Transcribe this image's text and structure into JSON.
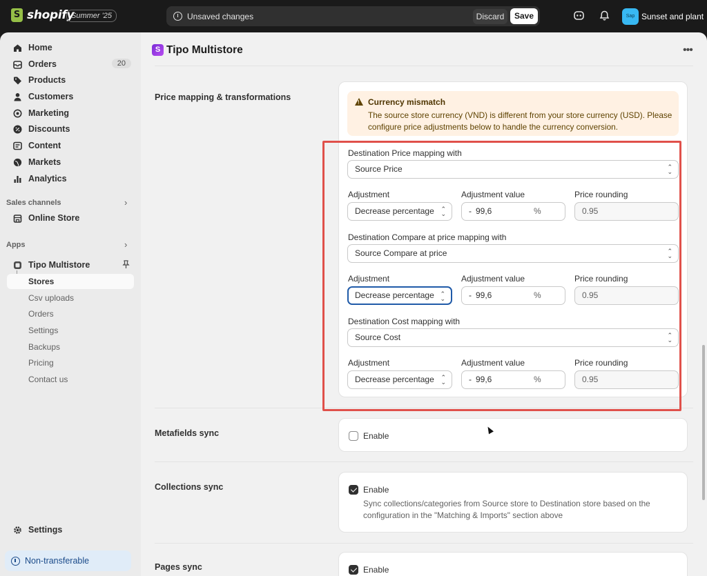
{
  "topbar": {
    "brand": "shopify",
    "edition_badge": "Summer '25",
    "unsaved_text": "Unsaved changes",
    "discard_label": "Discard",
    "save_label": "Save",
    "store_initials": "Sap",
    "store_name": "Sunset and plant"
  },
  "sidebar": {
    "items": [
      {
        "label": "Home",
        "icon": "home-icon"
      },
      {
        "label": "Orders",
        "icon": "orders-icon",
        "count": "20"
      },
      {
        "label": "Products",
        "icon": "tag-icon"
      },
      {
        "label": "Customers",
        "icon": "person-icon"
      },
      {
        "label": "Marketing",
        "icon": "target-icon"
      },
      {
        "label": "Discounts",
        "icon": "discount-icon"
      },
      {
        "label": "Content",
        "icon": "content-icon"
      },
      {
        "label": "Markets",
        "icon": "globe-icon"
      },
      {
        "label": "Analytics",
        "icon": "bar-chart-icon"
      }
    ],
    "sales_channels_label": "Sales channels",
    "online_store_label": "Online Store",
    "apps_label": "Apps",
    "app_name": "Tipo Multistore",
    "app_subitems": [
      "Stores",
      "Csv uploads",
      "Orders",
      "Settings",
      "Backups",
      "Pricing",
      "Contact us"
    ],
    "settings_label": "Settings",
    "nontransferable_label": "Non-transferable"
  },
  "main": {
    "app_title": "Tipo Multistore",
    "price_section_title": "Price mapping & transformations",
    "banner": {
      "title": "Currency mismatch",
      "text": "The source store currency (VND) is different from your store currency (USD). Please configure price adjustments below to handle the currency conversion."
    },
    "mappings": [
      {
        "label": "Destination Price mapping with",
        "source": "Source Price",
        "adjustment_label": "Adjustment",
        "adjustment": "Decrease percentage",
        "value_label": "Adjustment value",
        "value_prefix": "-",
        "value": "99,6",
        "value_suffix": "%",
        "rounding_label": "Price rounding",
        "rounding": "0.95"
      },
      {
        "label": "Destination Compare at price mapping with",
        "source": "Source Compare at price",
        "adjustment_label": "Adjustment",
        "adjustment": "Decrease percentage",
        "value_label": "Adjustment value",
        "value_prefix": "-",
        "value": "99,6",
        "value_suffix": "%",
        "rounding_label": "Price rounding",
        "rounding": "0.95"
      },
      {
        "label": "Destination Cost mapping with",
        "source": "Source Cost",
        "adjustment_label": "Adjustment",
        "adjustment": "Decrease percentage",
        "value_label": "Adjustment value",
        "value_prefix": "-",
        "value": "99,6",
        "value_suffix": "%",
        "rounding_label": "Price rounding",
        "rounding": "0.95"
      }
    ],
    "metafields": {
      "title": "Metafields sync",
      "enable_label": "Enable",
      "checked": false
    },
    "collections": {
      "title": "Collections sync",
      "enable_label": "Enable",
      "checked": true,
      "help": "Sync collections/categories from Source store to Destination store based on the configuration in the \"Matching & Imports\" section above"
    },
    "pages": {
      "title": "Pages sync",
      "enable_label": "Enable",
      "checked": true
    }
  }
}
